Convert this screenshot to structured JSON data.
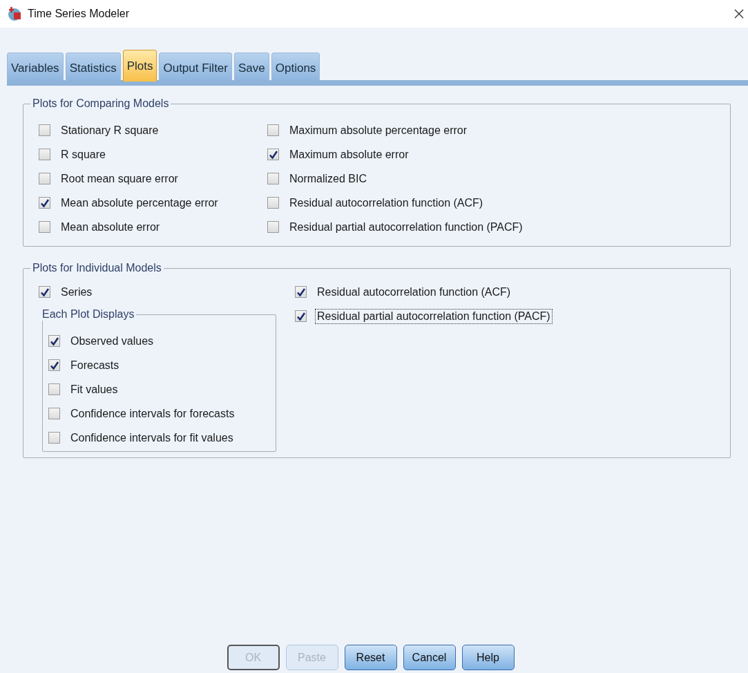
{
  "window": {
    "title": "Time Series Modeler"
  },
  "tabs": [
    {
      "label": "Variables",
      "selected": false
    },
    {
      "label": "Statistics",
      "selected": false
    },
    {
      "label": "Plots",
      "selected": true
    },
    {
      "label": "Output Filter",
      "selected": false
    },
    {
      "label": "Save",
      "selected": false
    },
    {
      "label": "Options",
      "selected": false
    }
  ],
  "comparing_models": {
    "title": "Plots for Comparing Models",
    "columns": [
      [
        {
          "label": "Stationary R square",
          "checked": false
        },
        {
          "label": "R square",
          "checked": false
        },
        {
          "label": "Root mean square error",
          "checked": false
        },
        {
          "label": "Mean absolute percentage error",
          "checked": true
        },
        {
          "label": "Mean absolute error",
          "checked": false
        }
      ],
      [
        {
          "label": "Maximum absolute percentage error",
          "checked": false
        },
        {
          "label": "Maximum absolute error",
          "checked": true
        },
        {
          "label": "Normalized BIC",
          "checked": false
        },
        {
          "label": "Residual autocorrelation function (ACF)",
          "checked": false
        },
        {
          "label": "Residual partial autocorrelation function (PACF)",
          "checked": false
        }
      ]
    ]
  },
  "individual_models": {
    "title": "Plots for Individual Models",
    "series": {
      "label": "Series",
      "checked": true
    },
    "each_plot_displays": {
      "title": "Each Plot Displays",
      "options": [
        {
          "label": "Observed values",
          "checked": true
        },
        {
          "label": "Forecasts",
          "checked": true
        },
        {
          "label": "Fit values",
          "checked": false
        },
        {
          "label": "Confidence intervals for forecasts",
          "checked": false
        },
        {
          "label": "Confidence intervals for fit values",
          "checked": false
        }
      ]
    },
    "residual_options": [
      {
        "label": "Residual autocorrelation function (ACF)",
        "checked": true,
        "focused": false
      },
      {
        "label": "Residual partial autocorrelation function (PACF)",
        "checked": true,
        "focused": true
      }
    ]
  },
  "buttons": [
    {
      "label": "OK",
      "disabled": true,
      "default": true
    },
    {
      "label": "Paste",
      "disabled": true,
      "default": false
    },
    {
      "label": "Reset",
      "disabled": false,
      "default": false
    },
    {
      "label": "Cancel",
      "disabled": false,
      "default": false
    },
    {
      "label": "Help",
      "disabled": false,
      "default": false
    }
  ]
}
